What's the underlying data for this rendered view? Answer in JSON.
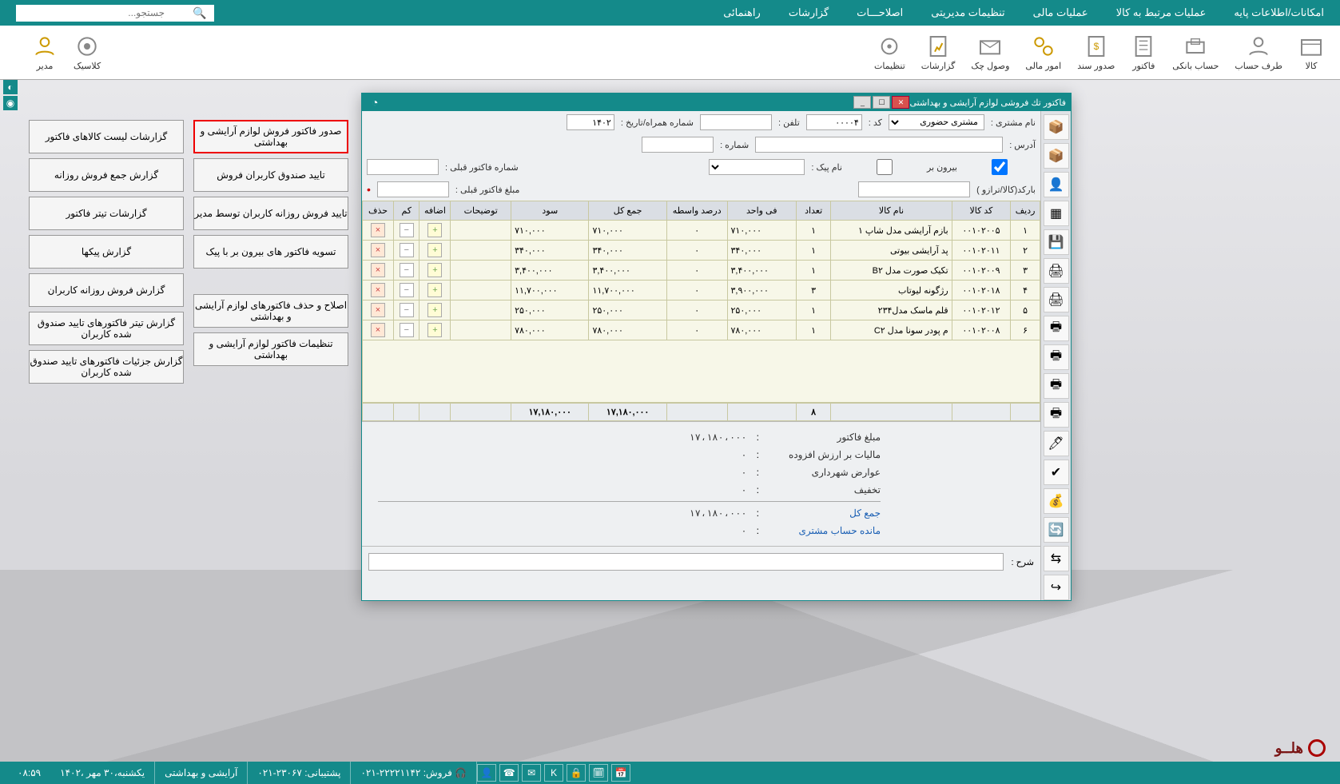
{
  "menubar": [
    "امکانات/اطلاعات پایه",
    "عملیات مرتبط به کالا",
    "عملیات مالی",
    "تنظیمات مدیریتی",
    "اصلاحـــات",
    "گزارشات",
    "راهنمائی"
  ],
  "search_placeholder": "جستجو...",
  "ribbon": [
    {
      "label": "کالا"
    },
    {
      "label": "طرف حساب"
    },
    {
      "label": "حساب بانکی"
    },
    {
      "label": "فاکتور"
    },
    {
      "label": "صدور سند"
    },
    {
      "label": "امور مالی"
    },
    {
      "label": "وصول چک"
    },
    {
      "label": "گزارشات"
    },
    {
      "label": "تنظیمات"
    }
  ],
  "ribbon_left": [
    {
      "label": "کلاسیک"
    },
    {
      "label": "مدیر"
    }
  ],
  "tiles_right": [
    "صدور فاکتور فروش لوازم آرایشی و بهداشتی",
    "تایید صندوق کاربران فروش",
    "تایید فروش روزانه کاربران توسط مدیر",
    "تسویه فاکتور های بیرون بر با پیک",
    "اصلاح و حذف فاکتورهای لوازم آرایشی و بهداشتی",
    "تنظیمات فاکتور لوازم آرایشی و بهداشتی"
  ],
  "tiles_left": [
    "گزارشات لیست کالاهای فاکتور",
    "گزارش جمع فروش روزانه",
    "گزارشات تیتر فاکتور",
    "گزارش پیکها",
    "گزارش فروش روزانه کاربران",
    "گزارش تیتر فاکتورهای تایید صندوق شده کاربران",
    "گزارش جزئیات فاکتورهای تایید صندوق شده کاربران"
  ],
  "inv": {
    "title": "فاکتور تك فروشی لوازم آرایشی و بهداشتی",
    "labels": {
      "customer": "نام مشتری :",
      "code": "کد      :",
      "tel": "تلفن :",
      "mobile": "شماره همراه/تاريخ      :",
      "address": "آدرس      :",
      "number": "شماره      :",
      "out": "بیرون بر",
      "courier": "نام پیک :",
      "prev_no": "شماره فاکتور قبلی :",
      "barcode": "بارکد(کالا/ترازو )",
      "prev_amt": "مبلغ فاکتور قبلی :",
      "desc": "شرح   :"
    },
    "customer_type": "مشتری حضوری",
    "code": "۰۰۰۰۴",
    "date": "۱۴۰۲",
    "columns": [
      "ردیف",
      "کد کالا",
      "نام کالا",
      "تعداد",
      "فی واحد",
      "درصد واسطه",
      "جمع کل",
      "سود",
      "توضیحات",
      "اضافه",
      "کم",
      "حذف"
    ],
    "rows": [
      {
        "r": "۱",
        "code": "۰۰۱۰۲۰۰۵",
        "name": "بازم آرایشی مدل شاپ ۱",
        "qty": "۱",
        "unit": "۷۱۰,۰۰۰",
        "pct": "۰",
        "total": "۷۱۰,۰۰۰",
        "profit": "۷۱۰,۰۰۰"
      },
      {
        "r": "۲",
        "code": "۰۰۱۰۲۰۱۱",
        "name": "پد آرایشی بیوتی",
        "qty": "۱",
        "unit": "۳۴۰,۰۰۰",
        "pct": "۰",
        "total": "۳۴۰,۰۰۰",
        "profit": "۳۴۰,۰۰۰"
      },
      {
        "r": "۳",
        "code": "۰۰۱۰۲۰۰۹",
        "name": "تکیک صورت مدل B۲",
        "qty": "۱",
        "unit": "۳,۴۰۰,۰۰۰",
        "pct": "۰",
        "total": "۳,۴۰۰,۰۰۰",
        "profit": "۳,۴۰۰,۰۰۰"
      },
      {
        "r": "۴",
        "code": "۰۰۱۰۲۰۱۸",
        "name": "رژگونه لیوتاب",
        "qty": "۳",
        "unit": "۳,۹۰۰,۰۰۰",
        "pct": "۰",
        "total": "۱۱,۷۰۰,۰۰۰",
        "profit": "۱۱,۷۰۰,۰۰۰"
      },
      {
        "r": "۵",
        "code": "۰۰۱۰۲۰۱۲",
        "name": "قلم ماسک مدل۲۳۴",
        "qty": "۱",
        "unit": "۲۵۰,۰۰۰",
        "pct": "۰",
        "total": "۲۵۰,۰۰۰",
        "profit": "۲۵۰,۰۰۰"
      },
      {
        "r": "۶",
        "code": "۰۰۱۰۲۰۰۸",
        "name": "م پودر سونا مدل C۲",
        "qty": "۱",
        "unit": "۷۸۰,۰۰۰",
        "pct": "۰",
        "total": "۷۸۰,۰۰۰",
        "profit": "۷۸۰,۰۰۰"
      }
    ],
    "totals": {
      "qty": "۸",
      "sum": "۱۷,۱۸۰,۰۰۰",
      "profit": "۱۷,۱۸۰,۰۰۰"
    },
    "summary": {
      "amount_lbl": "مبلغ فاکتور",
      "amount": "۱۷،۱۸۰،۰۰۰",
      "vat_lbl": "مالیات بر ارزش افزوده",
      "vat": "۰",
      "mun_lbl": "عوارض شهرداری",
      "mun": "۰",
      "disc_lbl": "تخفیف",
      "disc": "۰",
      "grand_lbl": "جمع کل",
      "grand": "۱۷،۱۸۰،۰۰۰",
      "bal_lbl": "مانده حساب مشتری",
      "bal": "۰"
    }
  },
  "brand": "هلــو",
  "status": {
    "sales_lbl": "فروش:",
    "sales_phone": "۰۲۱-۲۲۲۲۱۱۴۲",
    "sup_lbl": "پشتیبانی:",
    "sup_phone": "۰۲۱-۲۳۰۶۷",
    "shop": "آرایشی و بهداشتی",
    "date": "یکشنبه،۳۰ مهر ،۱۴۰۲",
    "time": "۰۸:۵۹"
  }
}
